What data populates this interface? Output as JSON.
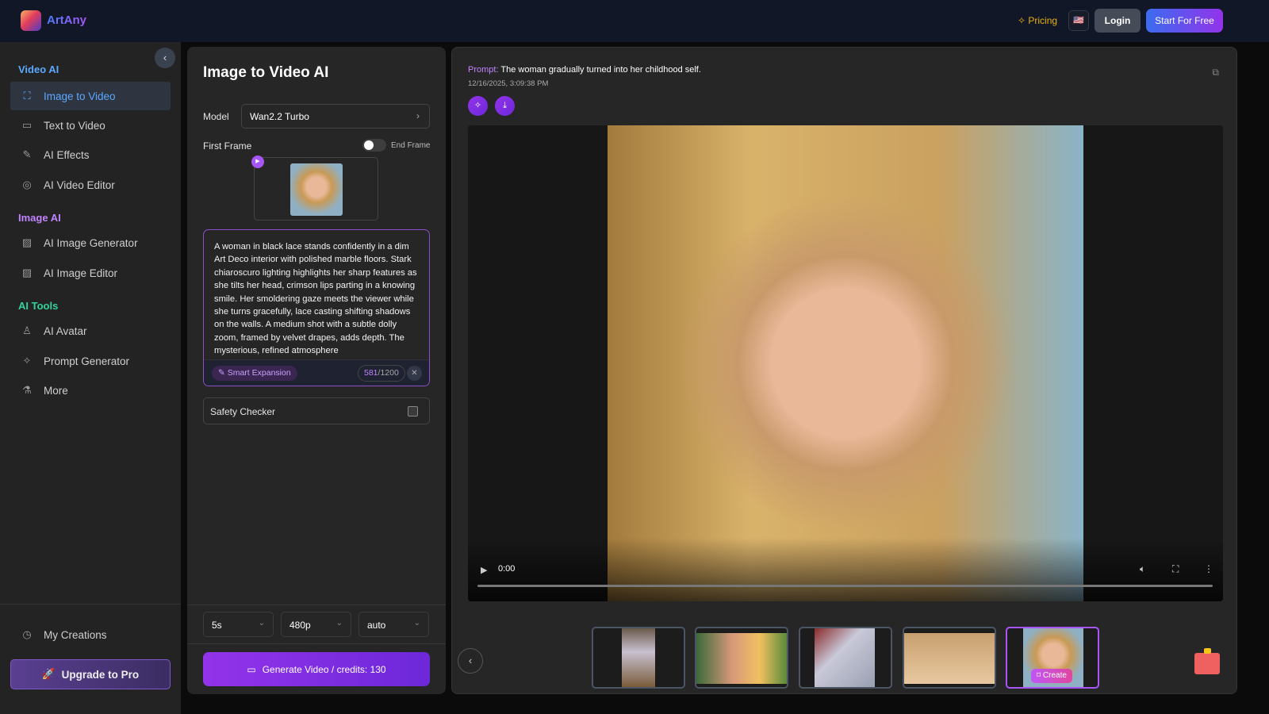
{
  "header": {
    "brand": "ArtAny",
    "pricing": "Pricing",
    "flag": "🇺🇸",
    "login": "Login",
    "start": "Start For Free"
  },
  "sidebar": {
    "sections": [
      {
        "title": "Video AI",
        "color": "#5aa9ff",
        "items": [
          {
            "label": "Image to Video",
            "icon": "expand-icon",
            "active": true
          },
          {
            "label": "Text to Video",
            "icon": "video-camera-icon"
          },
          {
            "label": "AI Effects",
            "icon": "brush-icon"
          },
          {
            "label": "AI Video Editor",
            "icon": "film-reel-icon"
          }
        ]
      },
      {
        "title": "Image AI",
        "color": "#c084fc",
        "items": [
          {
            "label": "AI Image Generator",
            "icon": "image-icon"
          },
          {
            "label": "AI Image Editor",
            "icon": "image-edit-icon"
          }
        ]
      },
      {
        "title": "AI Tools",
        "color": "#34d399",
        "items": [
          {
            "label": "AI Avatar",
            "icon": "user-icon"
          },
          {
            "label": "Prompt Generator",
            "icon": "sparkles-icon"
          },
          {
            "label": "More",
            "icon": "flask-icon"
          }
        ]
      }
    ],
    "my_creations": "My Creations",
    "upgrade": "Upgrade to Pro"
  },
  "form": {
    "title": "Image to Video AI",
    "model_label": "Model",
    "model_value": "Wan2.2 Turbo",
    "first_frame": "First Frame",
    "end_frame": "End Frame",
    "end_frame_enabled": false,
    "prompt": "A woman in black lace stands confidently in a dim Art Deco interior with polished marble floors. Stark chiaroscuro lighting highlights her sharp features as she tilts her head, crimson lips parting in a knowing smile. Her smoldering gaze meets the viewer while she turns gracefully, lace casting shifting shadows on the walls. A medium shot with a subtle dolly zoom, framed by velvet drapes, adds depth. The mysterious, refined atmosphere",
    "smart_expansion": "Smart Expansion",
    "count_used": "581",
    "count_max": "/1200",
    "safety_checker": "Safety Checker",
    "safety_checked": false,
    "duration": "5s",
    "resolution": "480p",
    "aspect": "auto",
    "generate": "Generate Video /  credits: 130"
  },
  "result": {
    "prompt_key": "Prompt:",
    "prompt_text": "The woman gradually turned into her childhood self.",
    "date": "12/16/2025, 3:09:38 PM",
    "video_time": "0:00",
    "create_label": "Create"
  }
}
